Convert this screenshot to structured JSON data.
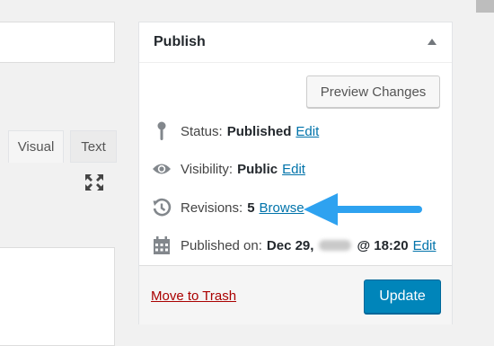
{
  "editor": {
    "tabs": [
      {
        "label": "Visual"
      },
      {
        "label": "Text"
      }
    ]
  },
  "publish": {
    "title": "Publish",
    "preview_label": "Preview Changes",
    "status": {
      "label": "Status:",
      "value": "Published",
      "edit": "Edit"
    },
    "visibility": {
      "label": "Visibility:",
      "value": "Public",
      "edit": "Edit"
    },
    "revisions": {
      "label": "Revisions:",
      "value": "5",
      "browse": "Browse"
    },
    "published_on": {
      "label": "Published on:",
      "date": "Dec 29,",
      "time": "@ 18:20",
      "edit": "Edit"
    },
    "trash_label": "Move to Trash",
    "update_label": "Update"
  },
  "colors": {
    "link": "#0073aa",
    "trash": "#aa0000",
    "primary": "#0085ba",
    "annotation_arrow": "#2ea2f0"
  }
}
